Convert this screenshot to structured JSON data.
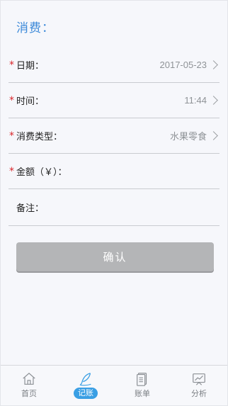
{
  "header": {
    "title": "消费："
  },
  "form": {
    "date": {
      "label": "日期：",
      "value": "2017-05-23"
    },
    "time": {
      "label": "时间：",
      "value": "11:44"
    },
    "type": {
      "label": "消费类型：",
      "value": "水果零食"
    },
    "amount": {
      "label": "金额（￥）：",
      "value": ""
    },
    "note": {
      "label": "备注：",
      "value": ""
    },
    "required_mark": "*"
  },
  "confirm": {
    "label": "确认"
  },
  "tabbar": {
    "items": [
      {
        "label": "首页",
        "icon": "home-icon",
        "active": false
      },
      {
        "label": "记账",
        "icon": "feather-pen-icon",
        "active": true
      },
      {
        "label": "账单",
        "icon": "document-icon",
        "active": false
      },
      {
        "label": "分析",
        "icon": "chart-icon",
        "active": false
      }
    ]
  },
  "colors": {
    "accent": "#3a9fe4",
    "title": "#3d8ad9",
    "required": "#d9252a",
    "button": "#b4b5b7"
  }
}
